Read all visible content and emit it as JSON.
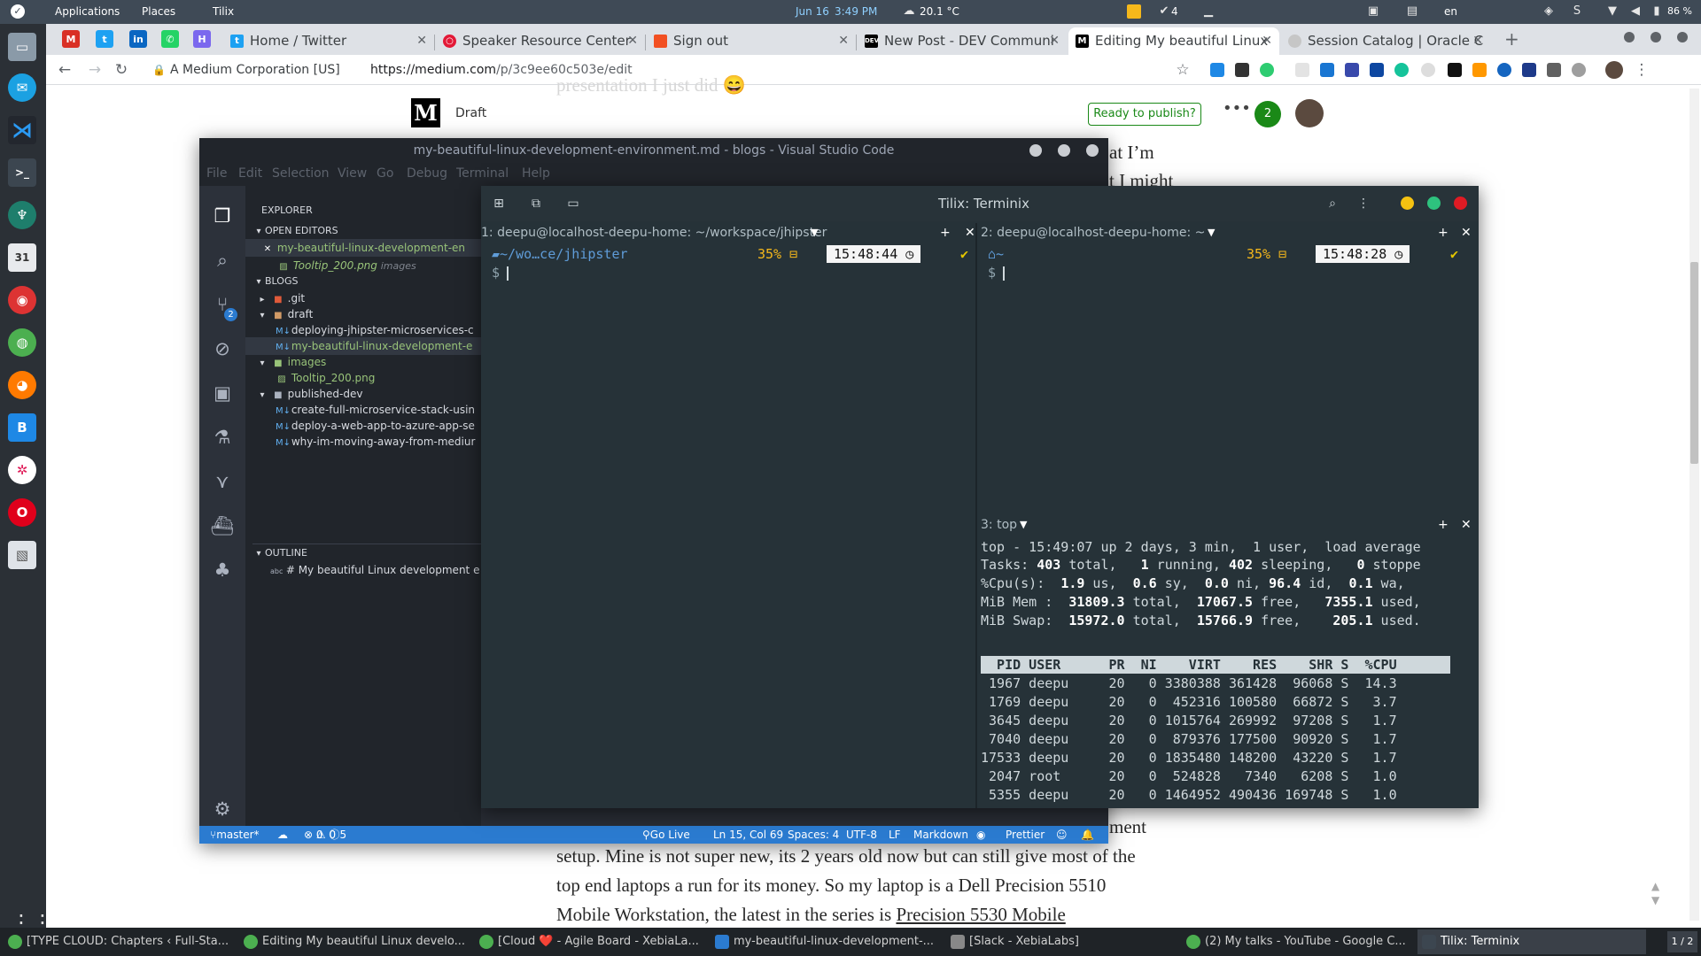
{
  "topbar": {
    "applications": "Applications",
    "places": "Places",
    "tilix": "Tilix",
    "date": "Jun 16",
    "time": "3:49 PM",
    "weather": "20.1 °C",
    "tasks": "4",
    "lang": "en",
    "battery": "86 %"
  },
  "chrome": {
    "tabs": [
      {
        "title": "Home / Twitter",
        "favicon": "twitter-icon",
        "color": "#1da1f2"
      },
      {
        "title": "Speaker Resource Center",
        "favicon": "oracle-icon",
        "color": "#e31937"
      },
      {
        "title": "Sign out",
        "favicon": "microsoft-icon",
        "color": "#f25022"
      },
      {
        "title": "New Post - DEV Communi",
        "favicon": "dev-icon",
        "color": "#000000"
      },
      {
        "title": "Editing My beautiful Linux",
        "favicon": "medium-icon",
        "color": "#000000"
      },
      {
        "title": "Session Catalog | Oracle C",
        "favicon": "oracle-icon",
        "color": "#e31937"
      }
    ],
    "new_tab": "+",
    "org": "A Medium Corporation [US]",
    "url_host": "https://medium.com",
    "url_path": "/p/3c9ee60c503e/edit"
  },
  "medium": {
    "logo": "M",
    "status": "Draft",
    "publish_button": "Ready to publish?",
    "more": "•••",
    "notif_count": "2",
    "ghost_line1": "presentation I just did 😄",
    "frag1": "at I’m",
    "frag2": "t I might",
    "frag3": "ment",
    "para_line1": "setup. Mine is not super new, its 2 years old now but can still give most of the",
    "para_line2": "top end laptops a run for its money. So my laptop is a Dell Precision 5510",
    "para_line3": "Mobile Workstation, the latest in the series is",
    "para_link": "Precision 5530 Mobile",
    "bottom_prompt": "$"
  },
  "vscode": {
    "title": "my-beautiful-linux-development-environment.md - blogs - Visual Studio Code",
    "menu": [
      "File",
      "Edit",
      "Selection",
      "View",
      "Go",
      "Debug",
      "Terminal",
      "Help"
    ],
    "explorer": "EXPLORER",
    "open_editors": "OPEN EDITORS",
    "open_files": [
      {
        "name": "my-beautiful-linux-development-en",
        "extra": ""
      },
      {
        "name": "Tooltip_200.png",
        "extra": "images"
      }
    ],
    "blogs": "BLOGS",
    "tree": {
      "git": ".git",
      "draft": "draft",
      "draft_files": [
        "deploying-jhipster-microservices-c",
        "my-beautiful-linux-development-e"
      ],
      "images": "images",
      "image_files": [
        "Tooltip_200.png"
      ],
      "published": "published-dev",
      "published_files": [
        "create-full-microservice-stack-usin",
        "deploy-a-web-app-to-azure-app-se",
        "why-im-moving-away-from-mediur"
      ]
    },
    "outline": "OUTLINE",
    "outline_item": "# My beautiful Linux development e",
    "scm_badge": "2",
    "status": {
      "branch": "master*",
      "problems_errors": "0",
      "problems_warnings": "0",
      "problems_info": "5",
      "golive": "Go Live",
      "position": "Ln 15, Col 69",
      "spaces": "Spaces: 4",
      "encoding": "UTF-8",
      "eol": "LF",
      "language": "Markdown",
      "prettier": "Prettier"
    }
  },
  "tilix": {
    "title": "Tilix: Terminix",
    "pane1": {
      "title": "1: deepu@localhost-deepu-home: ~/workspace/jhipster",
      "path": "~/wo…ce/jhipster",
      "battery": "35%",
      "time": "15:48:44",
      "prompt": "$"
    },
    "pane2": {
      "title": "2: deepu@localhost-deepu-home: ~",
      "path": "~",
      "battery": "35%",
      "time": "15:48:28",
      "prompt": "$"
    },
    "pane3": {
      "title": "3: top"
    },
    "top": {
      "line1": "top - 15:49:07 up 2 days, 3 min,  1 user,  load average",
      "tasks_label": "Tasks:",
      "tasks_total": "403",
      "tasks_running": "1",
      "tasks_sleeping": "402",
      "tasks_stopped": "0",
      "cpu_label": "%Cpu(s):",
      "cpu_us": "1.9",
      "cpu_sy": "0.6",
      "cpu_ni": "0.0",
      "cpu_id": "96.4",
      "cpu_wa": "0.1",
      "mem_label": "MiB Mem :",
      "mem_total": "31809.3",
      "mem_free": "17067.5",
      "mem_used": "7355.1",
      "swap_label": "MiB Swap:",
      "swap_total": "15972.0",
      "swap_free": "15766.9",
      "swap_used": "205.1",
      "header": "  PID USER      PR  NI    VIRT    RES    SHR S  %CPU",
      "processes": [
        " 1967 deepu     20   0 3380388 361428  96068 S  14.3",
        " 1769 deepu     20   0  452316 100580  66872 S   3.7",
        " 3645 deepu     20   0 1015764 269992  97208 S   1.7",
        " 7040 deepu     20   0  879376 177500  90920 S   1.7",
        "17533 deepu     20   0 1835480 148200  43220 S   1.7",
        " 2047 root      20   0  524828   7340   6208 S   1.0",
        " 5355 deepu     20   0 1464952 490436 169748 S   1.0"
      ]
    }
  },
  "taskbar": {
    "items": [
      "[TYPE CLOUD: Chapters ‹ Full-Sta...",
      "Editing My beautiful Linux develo...",
      "[Cloud ❤️ - Agile Board - XebiaLa...",
      "my-beautiful-linux-development-...",
      "[Slack - XebiaLabs]",
      "(2) My talks - YouTube - Google C...",
      "Tilix: Terminix"
    ],
    "pager": "1 / 2"
  }
}
